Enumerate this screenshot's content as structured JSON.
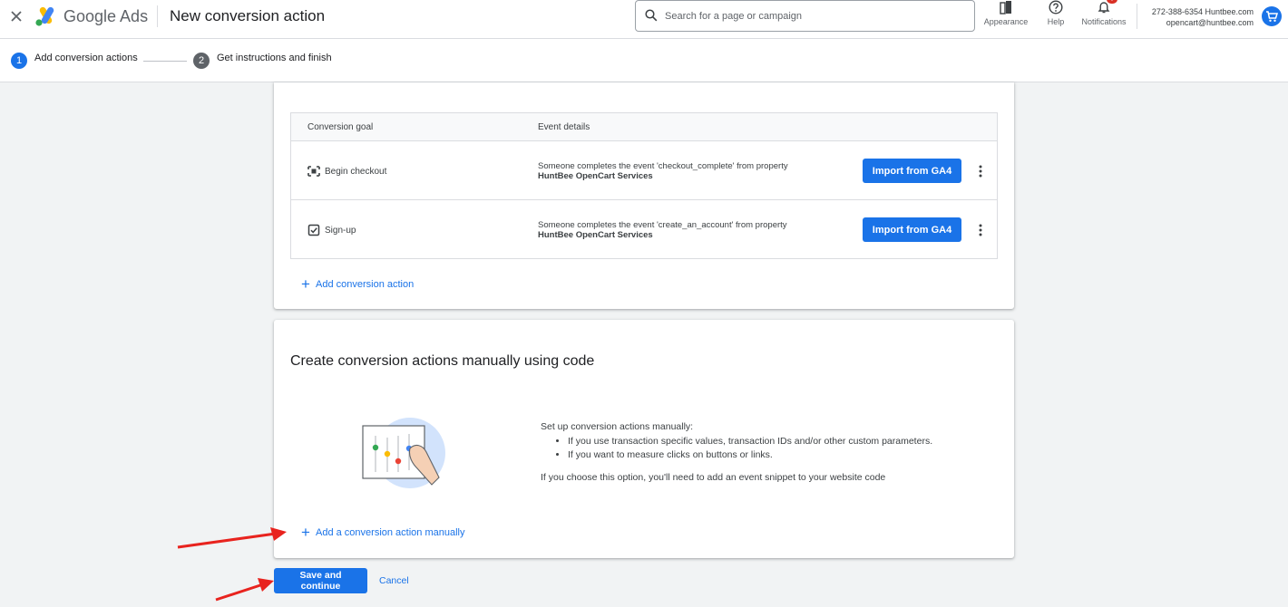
{
  "header": {
    "brand": "Google Ads",
    "page_title": "New conversion action",
    "search_placeholder": "Search for a page or campaign",
    "appearance_label": "Appearance",
    "help_label": "Help",
    "notifications_label": "Notifications",
    "notifications_badge": "!",
    "account_line1": "272-388-6354 Huntbee.com",
    "account_line2": "opencart@huntbee.com"
  },
  "stepper": {
    "steps": [
      {
        "number": "1",
        "label": "Add conversion actions",
        "active": true
      },
      {
        "number": "2",
        "label": "Get instructions and finish",
        "active": false
      }
    ]
  },
  "ga4_table": {
    "columns": [
      "Conversion goal",
      "Event details"
    ],
    "rows": [
      {
        "goal_icon": "checkout-icon",
        "goal": "Begin checkout",
        "detail_text": "Someone completes the event 'checkout_complete' from property",
        "property": "HuntBee OpenCart Services",
        "action_label": "Import from GA4"
      },
      {
        "goal_icon": "checkbox-icon",
        "goal": "Sign-up",
        "detail_text": "Someone completes the event 'create_an_account' from property",
        "property": "HuntBee OpenCart Services",
        "action_label": "Import from GA4"
      }
    ],
    "add_label": "Add conversion action"
  },
  "manual": {
    "title": "Create conversion actions manually using code",
    "intro": "Set up conversion actions manually:",
    "bullets": [
      "If you use transaction specific values, transaction IDs and/or other custom parameters.",
      "If you want to measure clicks on buttons or links."
    ],
    "note": "If you choose this option, you'll need to add an event snippet to your website code",
    "add_label": "Add a conversion action manually"
  },
  "footer": {
    "save_label": "Save and continue",
    "cancel_label": "Cancel"
  },
  "colors": {
    "accent": "#1a73e8",
    "annotation_arrow": "#e8231e"
  }
}
